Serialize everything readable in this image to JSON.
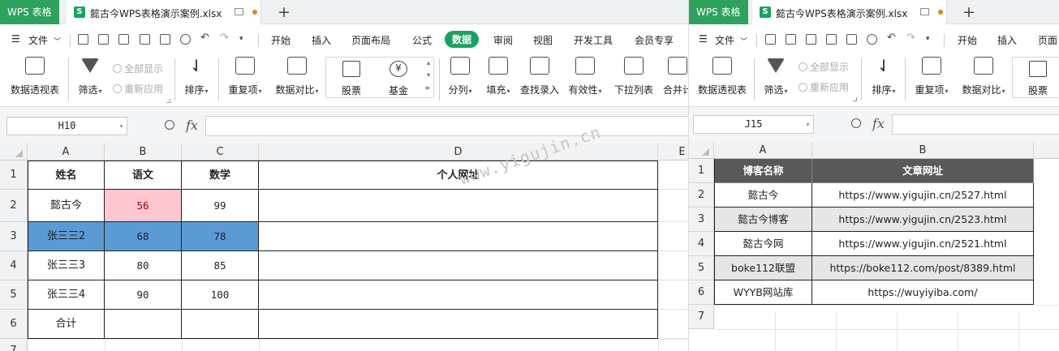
{
  "left": {
    "app_badge": "WPS 表格",
    "doc_title": "懿古今WPS表格演示案例.xlsx",
    "menu": {
      "file": "文件",
      "tabs": [
        "开始",
        "插入",
        "页面布局",
        "公式",
        "数据",
        "审阅",
        "视图",
        "开发工具",
        "会员专享"
      ],
      "active_tab": "数据"
    },
    "ribbon": {
      "pivot": "数据透视表",
      "filter": "筛选",
      "show_all": "全部显示",
      "reapply": "重新应用",
      "sort": "排序",
      "duplicates": "重复项",
      "compare": "数据对比",
      "stock": "股票",
      "fund": "基金",
      "split": "分列",
      "fill": "填充",
      "lookup": "查找录入",
      "validity": "有效性",
      "dropdown": "下拉列表",
      "merge": "合并计"
    },
    "name_box": "H10",
    "fx": "fx",
    "columns": [
      "A",
      "B",
      "C",
      "D",
      "E"
    ],
    "rows": [
      "1",
      "2",
      "3",
      "4",
      "5",
      "6",
      "7"
    ],
    "table": [
      [
        "姓名",
        "语文",
        "数学",
        "个人网址"
      ],
      [
        "懿古今",
        "56",
        "99",
        ""
      ],
      [
        "张三三2",
        "68",
        "78",
        ""
      ],
      [
        "张三三3",
        "80",
        "85",
        ""
      ],
      [
        "张三三4",
        "90",
        "100",
        ""
      ],
      [
        "合计",
        "",
        "",
        ""
      ]
    ],
    "watermark": "www.yigujin.cn"
  },
  "right": {
    "app_badge": "WPS 表格",
    "doc_title": "懿古今WPS表格演示案例.xlsx",
    "menu": {
      "file": "文件",
      "tabs": [
        "开始",
        "插入",
        "页面"
      ]
    },
    "ribbon": {
      "pivot": "数据透视表",
      "filter": "筛选",
      "show_all": "全部显示",
      "reapply": "重新应用",
      "sort": "排序",
      "duplicates": "重复项",
      "compare": "数据对比",
      "stock": "股票"
    },
    "name_box": "J15",
    "fx": "fx",
    "columns": [
      "A",
      "B"
    ],
    "rows": [
      "1",
      "2",
      "3",
      "4",
      "5",
      "6",
      "7"
    ],
    "table": [
      [
        "博客名称",
        "文章网址"
      ],
      [
        "懿古今",
        "https://www.yigujin.cn/2527.html"
      ],
      [
        "懿古今博客",
        "https://www.yigujin.cn/2523.html"
      ],
      [
        "懿古今网",
        "https://www.yigujin.cn/2521.html"
      ],
      [
        "boke112联盟",
        "https://boke112.com/post/8389.html"
      ],
      [
        "WYYB网站库",
        "https://wuyiyiba.com/"
      ]
    ]
  },
  "colors": {
    "wps_green": "#2fa15f",
    "active_tab": "#1aa260",
    "pink_fill": "#ffc7ce",
    "blue_fill": "#5b9bd5",
    "header_dark": "#595959",
    "band_grey": "#e7e6e6"
  }
}
